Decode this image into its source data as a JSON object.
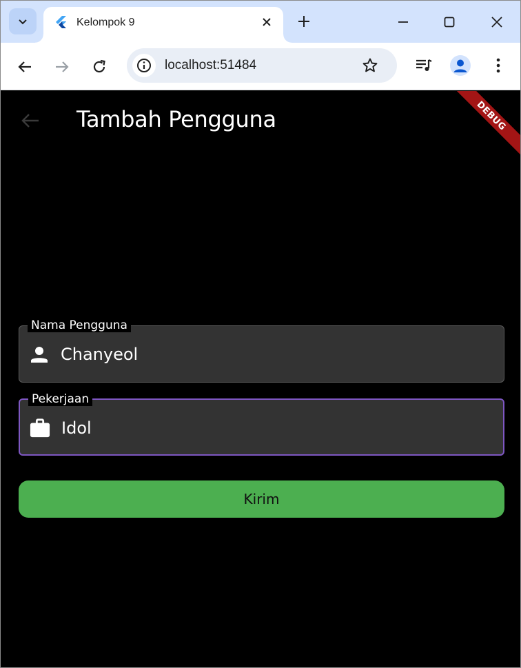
{
  "browser": {
    "tab": {
      "title": "Kelompok 9",
      "favicon": "flutter-icon"
    },
    "address": "localhost:51484",
    "icons": {
      "tab_search": "chevron-down-icon",
      "close_tab": "close-icon",
      "new_tab": "plus-icon",
      "minimize": "minimize-icon",
      "maximize": "maximize-icon",
      "close_window": "close-icon",
      "back": "arrow-left-icon",
      "forward": "arrow-right-icon",
      "reload": "reload-icon",
      "site_info": "info-icon",
      "bookmark": "star-icon",
      "media": "media-queue-icon",
      "profile": "profile-icon",
      "menu": "kebab-menu-icon"
    }
  },
  "app": {
    "title": "Tambah Pengguna",
    "debug_banner": "DEBUG",
    "fields": [
      {
        "label": "Nama Pengguna",
        "value": "Chanyeol",
        "icon": "person-icon",
        "focused": false
      },
      {
        "label": "Pekerjaan",
        "value": "Idol",
        "icon": "briefcase-icon",
        "focused": true
      }
    ],
    "submit_label": "Kirim"
  },
  "colors": {
    "background": "#000000",
    "field_fill": "#333333",
    "focus_border": "#7e57c2",
    "button": "#4caf50",
    "debug_banner": "#a31515",
    "tabstrip": "#d3e3fd"
  }
}
